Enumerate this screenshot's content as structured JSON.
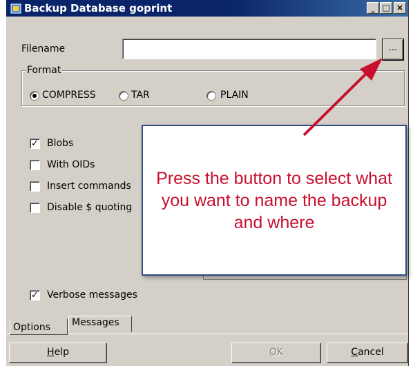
{
  "window": {
    "title": "Backup Database goprint",
    "controls": {
      "minimize": "_",
      "maximize": "□",
      "close": "×"
    }
  },
  "filename": {
    "label": "Filename",
    "value": "",
    "browse_label": "..."
  },
  "format": {
    "legend": "Format",
    "options": [
      {
        "label": "COMPRESS",
        "selected": true
      },
      {
        "label": "TAR",
        "selected": false
      },
      {
        "label": "PLAIN",
        "selected": false
      }
    ]
  },
  "checkboxes": {
    "blobs": {
      "label": "Blobs",
      "checked": true
    },
    "with_oids": {
      "label": "With OIDs",
      "checked": false
    },
    "insert_commands": {
      "label": "Insert commands",
      "checked": false
    },
    "disable_quoting": {
      "label": "Disable $ quoting",
      "checked": false
    },
    "verbose": {
      "label": "Verbose messages",
      "checked": true
    }
  },
  "callout": {
    "text": "Press the button to select what you want to name the backup and where"
  },
  "tabs": [
    {
      "label": "Options",
      "active": true
    },
    {
      "label": "Messages",
      "active": false
    }
  ],
  "buttons": {
    "help": {
      "prefix": "",
      "mnemonic": "H",
      "rest": "elp"
    },
    "ok": {
      "prefix": "",
      "mnemonic": "O",
      "rest": "K",
      "enabled": false
    },
    "cancel": {
      "prefix": "",
      "mnemonic": "C",
      "rest": "ancel"
    }
  },
  "colors": {
    "title_bar": "#0a246a",
    "callout_text": "#c8102e",
    "callout_border": "#2f4a86",
    "arrow": "#c8102e"
  }
}
